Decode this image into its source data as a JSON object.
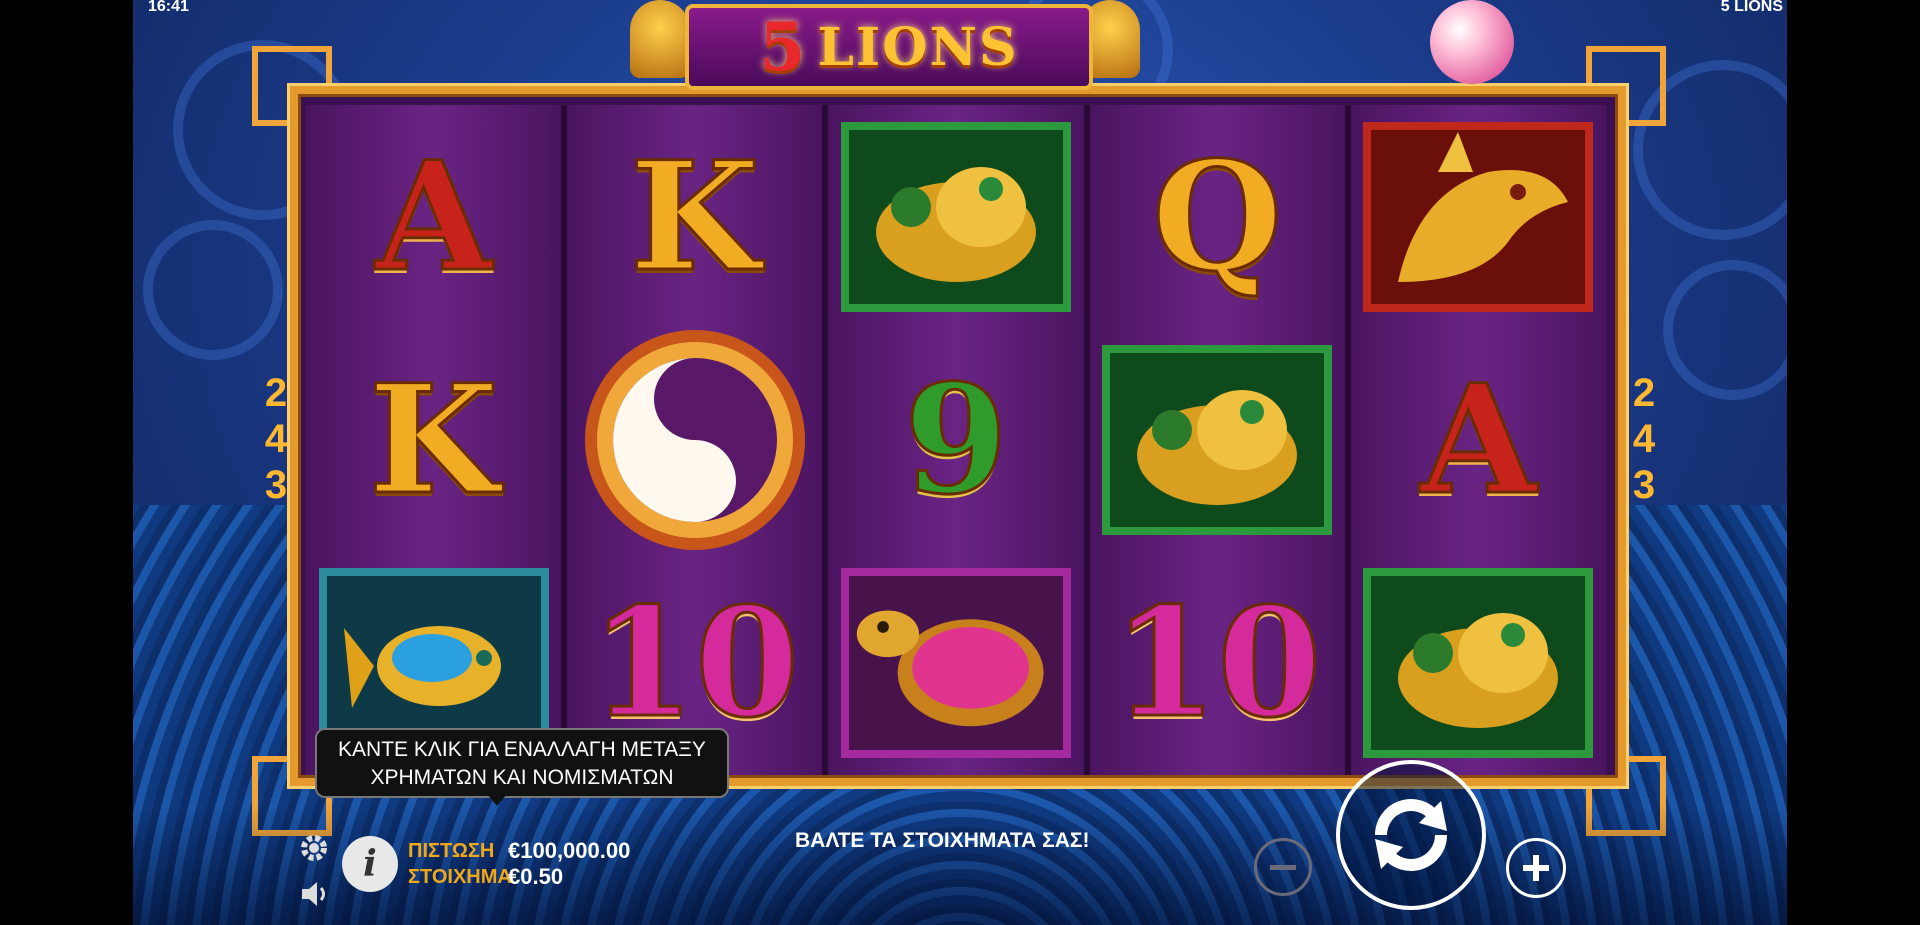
{
  "status": {
    "time": "16:41",
    "title": "5 LIONS"
  },
  "logo": {
    "digit": "5",
    "word": "LIONS"
  },
  "ways": {
    "left": [
      "2",
      "4",
      "3"
    ],
    "right": [
      "2",
      "4",
      "3"
    ]
  },
  "reels": [
    [
      {
        "sym": "A",
        "style": "red"
      },
      {
        "sym": "K",
        "style": "gold"
      },
      {
        "sym": "golden-koi-fish",
        "style": "teal"
      }
    ],
    [
      {
        "sym": "K",
        "style": "gold"
      },
      {
        "sym": "yin-yang-medallion",
        "style": "bonus"
      },
      {
        "sym": "10",
        "style": "pink"
      }
    ],
    [
      {
        "sym": "golden-toad",
        "style": "green"
      },
      {
        "sym": "9",
        "style": "green"
      },
      {
        "sym": "golden-turtle",
        "style": "purple"
      }
    ],
    [
      {
        "sym": "Q",
        "style": "gold"
      },
      {
        "sym": "golden-toad",
        "style": "green"
      },
      {
        "sym": "10",
        "style": "pink"
      }
    ],
    [
      {
        "sym": "golden-dragon",
        "style": "red"
      },
      {
        "sym": "A",
        "style": "red"
      },
      {
        "sym": "golden-toad",
        "style": "green"
      }
    ]
  ],
  "tooltip": {
    "line1": "ΚΑΝΤΕ ΚΛΙΚ ΓΙΑ ΕΝΑΛΛΑΓΗ ΜΕΤΑΞΥ",
    "line2": "ΧΡΗΜΑΤΩΝ ΚΑΙ ΝΟΜΙΣΜΑΤΩΝ"
  },
  "footer": {
    "credit_label": "ΠΙΣΤΩΣΗ",
    "credit_value": "€100,000.00",
    "bet_label": "ΣΤΟΙΧΗΜΑ",
    "bet_value": "€0.50",
    "message": "ΒΑΛΤΕ ΤΑ ΣΤΟΙΧΗΜΑΤΑ ΣΑΣ!"
  },
  "icons": [
    "gear-icon",
    "info-icon",
    "speaker-icon",
    "minus-icon",
    "spin-icon",
    "plus-icon"
  ]
}
